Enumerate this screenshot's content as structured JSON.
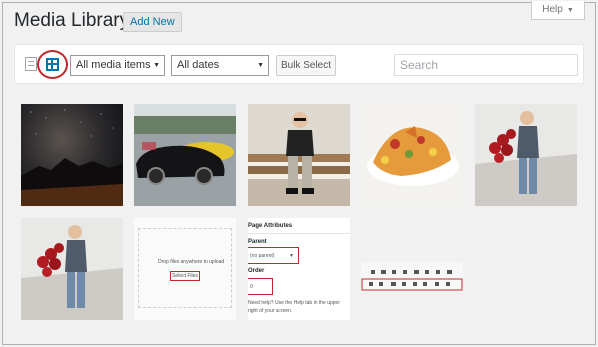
{
  "header": {
    "title": "Media Library",
    "add_new_label": "Add New",
    "help_label": "Help"
  },
  "toolbar": {
    "view_list_icon": "list-view-icon",
    "view_grid_icon": "grid-view-icon",
    "filter_type": {
      "selected": "All media items"
    },
    "filter_date": {
      "selected": "All dates"
    },
    "bulk_select_label": "Bulk Select",
    "search_placeholder": "Search"
  },
  "colors": {
    "accent": "#0073aa",
    "annotation_red": "#c0282b",
    "background": "#f1f1f1"
  },
  "thumbnails": [
    {
      "subject": "night sky over mountain"
    },
    {
      "subject": "cars in parking lot"
    },
    {
      "subject": "boy sitting on bench"
    },
    {
      "subject": "plate of food"
    },
    {
      "subject": "boy holding roses"
    },
    {
      "subject": "boy holding roses"
    },
    {
      "subject": "upload screen",
      "drop_text": "Drop files anywhere to upload",
      "button_text": "Select Files"
    },
    {
      "subject": "page attributes panel",
      "heading": "Page Attributes",
      "parent_label": "Parent",
      "parent_value": "(no parent)",
      "order_label": "Order",
      "order_value": "0",
      "help_line1": "Need help? Use the Help tab in the upper",
      "help_line2": "right of your screen."
    },
    {
      "subject": "editor toolbar"
    }
  ]
}
